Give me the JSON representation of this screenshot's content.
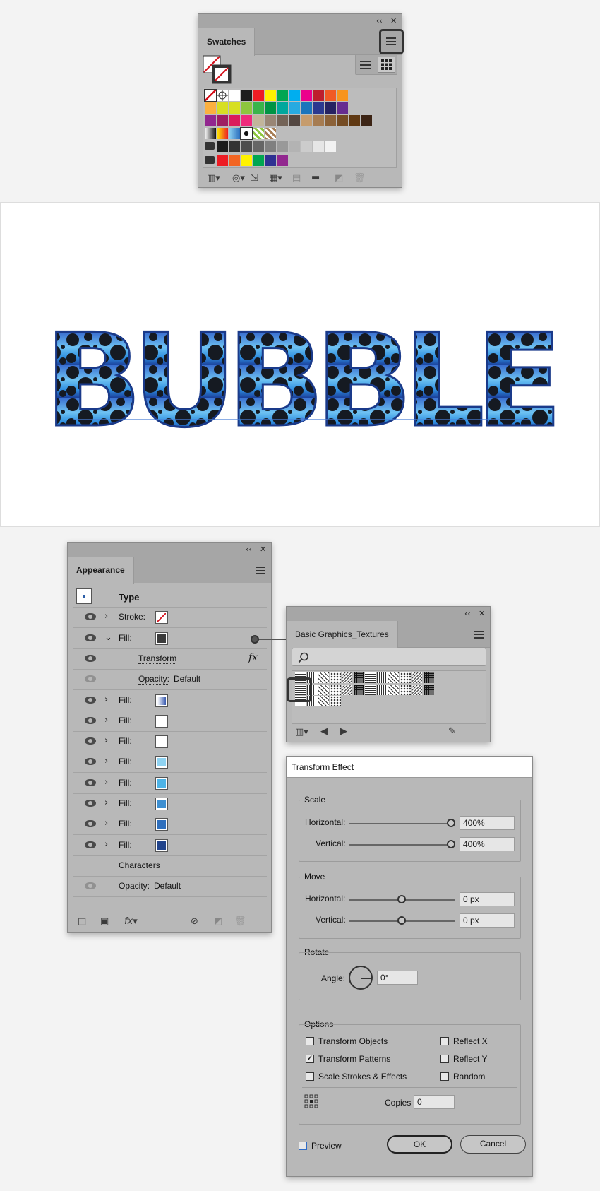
{
  "swatches_panel": {
    "tab_label": "Swatches",
    "collapse_icon": "double-chevron-left-icon",
    "close_icon": "close-icon",
    "menu_icon": "hamburger-menu-icon",
    "rows": [
      [
        "#ffffff",
        "#ffffff",
        "#ffffff",
        "#1c1c1c",
        "#ed1c24",
        "#fff200",
        "#00a651",
        "#00aeef",
        "#ec008c",
        "#be1e2d",
        "#f15a24",
        "#f7941d"
      ],
      [
        "#fbb040",
        "#d7df23",
        "#d7df23",
        "#8dc63f",
        "#39b54a",
        "#009444",
        "#00a79d",
        "#27aae1",
        "#1c75bc",
        "#2b3990",
        "#262262",
        "#662d91"
      ],
      [
        "#92278f",
        "#9e1f63",
        "#da1c5c",
        "#ee2a7b",
        "#c2b59b",
        "#998675",
        "#736357",
        "#534741",
        "#c69c6d",
        "#a67c52",
        "#8c6239",
        "#754c24",
        "#603913",
        "#3c2415"
      ],
      [
        "#ffffff",
        "#f7941d",
        "#6fa7d9",
        "#ffffff",
        "#8dc63f",
        "#a67c52"
      ],
      [
        "#1c1c1c",
        "#333333",
        "#4d4d4d",
        "#666666",
        "#808080",
        "#999999",
        "#b3b3b3",
        "#cccccc",
        "#e6e6e6",
        "#f2f2f2"
      ],
      [
        "#ed1c24",
        "#f26522",
        "#fff200",
        "#00a651",
        "#2e3192",
        "#92278f"
      ]
    ]
  },
  "canvas": {
    "art_text": "BUBBLE"
  },
  "appearance_panel": {
    "tab_label": "Appearance",
    "type_label": "Type",
    "stroke_label": "Stroke:",
    "fill_label": "Fill:",
    "transform_label": "Transform",
    "fx_label": "fx",
    "opacity_label": "Opacity:",
    "opacity_value": "Default",
    "characters_label": "Characters",
    "fill_colors": [
      "#ffffff",
      "#ffffff",
      "#ffffff",
      "#8fd3f2",
      "#4db3e6",
      "#3d8fd1",
      "#2f6fbd",
      "#22448c"
    ]
  },
  "textures_panel": {
    "tab_label": "Basic Graphics_Textures",
    "search_placeholder": ""
  },
  "transform_dialog": {
    "title": "Transform Effect",
    "scale_label": "Scale",
    "horizontal_label": "Horizontal:",
    "vertical_label": "Vertical:",
    "scale_h": "400%",
    "scale_v": "400%",
    "move_label": "Move",
    "move_h": "0 px",
    "move_v": "0 px",
    "rotate_label": "Rotate",
    "angle_label": "Angle:",
    "angle_value": "0°",
    "options_label": "Options",
    "transform_objects": "Transform Objects",
    "transform_patterns": "Transform Patterns",
    "scale_strokes": "Scale Strokes & Effects",
    "reflect_x": "Reflect X",
    "reflect_y": "Reflect Y",
    "random": "Random",
    "copies_label": "Copies",
    "copies_value": "0",
    "preview_label": "Preview",
    "ok_label": "OK",
    "cancel_label": "Cancel",
    "checked": {
      "transform_objects": false,
      "transform_patterns": true,
      "scale_strokes": false,
      "reflect_x": false,
      "reflect_y": false,
      "random": false,
      "preview": false
    }
  }
}
